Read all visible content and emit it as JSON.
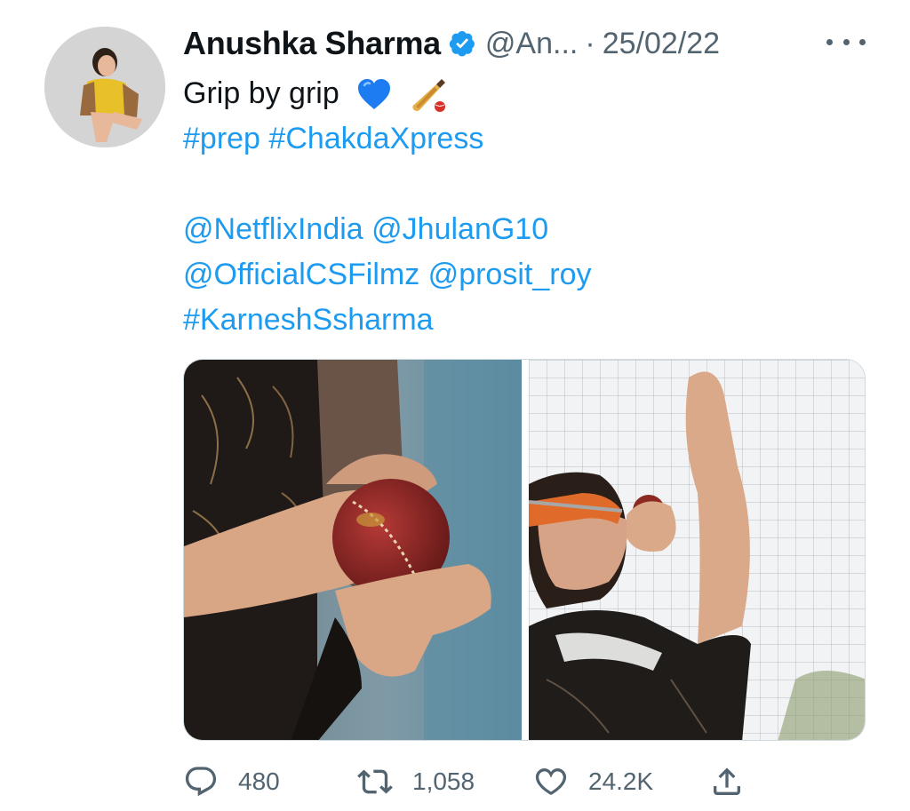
{
  "tweet": {
    "author_name": "Anushka Sharma",
    "handle": "@An...",
    "separator": "·",
    "date": "25/02/22",
    "text_line1": "Grip by grip",
    "hashtags_line": "#prep #ChakdaXpress",
    "mentions_line1": "@NetflixIndia @JhulanG10",
    "mentions_line2": "@OfficialCSFilmz @prosit_roy",
    "hashtag_line3": "#KarneshSsharma"
  },
  "actions": {
    "replies": "480",
    "retweets": "1,058",
    "likes": "24.2K"
  },
  "icons": {
    "verified": "verified-badge-icon",
    "more": "more-icon",
    "reply": "reply-icon",
    "retweet": "retweet-icon",
    "like": "heart-icon",
    "share": "share-icon",
    "emoji1": "blue-heart-icon",
    "emoji2": "cricket-bat-icon"
  },
  "colors": {
    "link": "#1d9bf0",
    "secondary_text": "#536471",
    "primary_text": "#0f1419"
  }
}
